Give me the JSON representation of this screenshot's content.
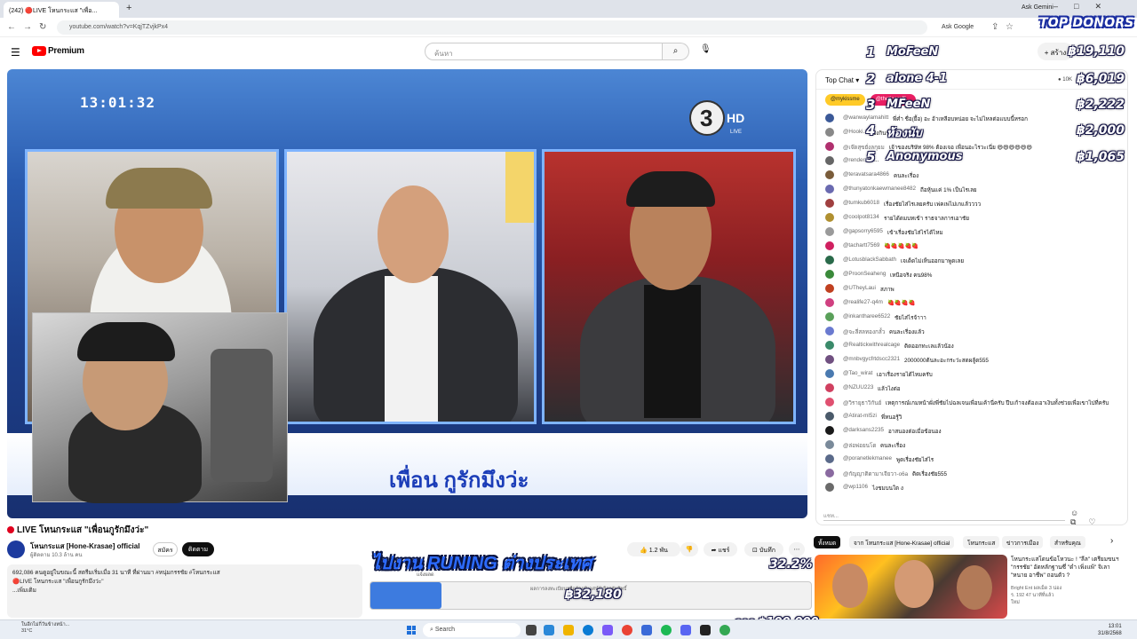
{
  "browser": {
    "tab_title": "(242) 🔴LIVE โหนกระแส \"เพื่อ...",
    "ask_gemini": "Ask Gemini",
    "url": "youtube.com/watch?v=KqjTZvjkPx4",
    "ask_google": "Ask Google"
  },
  "header": {
    "logo_text": "Premium",
    "search_placeholder": "ค้นหา",
    "create_label": "สร้าง"
  },
  "video": {
    "clock": "13:01:32",
    "channel_logo": "3 HD",
    "caption": "เพื่อน กูรักมึงว่ะ"
  },
  "watch": {
    "title": "LIVE โหนกระแส \"เพื่อนกูรักมึงว่ะ\"",
    "channel_name": "โหนกระแส [Hone-Krasae] official",
    "subscribers": "ผู้ติดตาม 10.3 ล้าน คน",
    "join_label": "สมัคร",
    "subscribe_label": "ติดตาม",
    "like_count": "1.2 พัน",
    "share_label": "แชร์",
    "save_label": "บันทึก",
    "description_lines": [
      "692,086 คนดูอยู่ในขณะนี้  สตรีมเริ่มเมื่อ 31 นาที ที่ผ่านมา  #หนุ่มกรรชัย #โหนกระแส",
      "🔴LIVE โหนกระแส \"เพื่อนกูรักมึงว่ะ\"",
      "...เพิ่มเติม"
    ]
  },
  "chat": {
    "mode_label": "Top Chat",
    "viewers": "10K",
    "pinned": [
      "@mykissme",
      "@thetigeroffi..."
    ],
    "messages": [
      {
        "author": "@wanwaylamahitt",
        "text": "พี่ค่ำ ชื่อ(ยื้อ) อะ อ้าเหลือบหน่อย จะไม่ไหลต่อแบบนี้หรอก",
        "color": "#3b5998"
      },
      {
        "author": "@Hooki...",
        "text": "ซิงกินรักใคร่ๆๆๆๆๆๆๆ",
        "color": "#888888"
      },
      {
        "author": "@เจ๊ดสุขยั่งลกุยม",
        "text": "เจ้าของบริษัท 98% ต้องเจอ เพื่อนอะไรวะเนี่ย 😄😄😄😄😄😄",
        "color": "#b0306e"
      },
      {
        "author": "@render...",
        "text": "...",
        "color": "#666666"
      },
      {
        "author": "@teravatsara4866",
        "text": "คนละเรื่อง",
        "color": "#7a5c3a"
      },
      {
        "author": "@thunyatonkaewmanee8482",
        "text": "ถือหุ้นแค่ 1% เป็นไรเลย",
        "color": "#6a6ab0"
      },
      {
        "author": "@tumkub6018",
        "text": "เรื่องชัยไส่ไรเลยครับ เพ่คเพ่ไม่เกแล้วววว",
        "color": "#a04040"
      },
      {
        "author": "@coolpot8134",
        "text": "รายได้ดมบทเข้า ราธจาลการเอาชัย",
        "color": "#b09030"
      },
      {
        "author": "@gapsorry6595",
        "text": "เข้าเรื่องชัยไส่ไรได้ไหม",
        "color": "#9a9a9a"
      },
      {
        "author": "@tachartt7569",
        "text": "🍓🍓🍓🍓🍓",
        "color": "#d02060"
      },
      {
        "author": "@LotusblackSabbath",
        "text": "เจเด็ดไม่เห็นออกมาพูดเลย",
        "color": "#2a6a4a"
      },
      {
        "author": "@ProonSeaheng",
        "text": "เหนือจริง คน98%",
        "color": "#3a8a3a"
      },
      {
        "author": "@UTheyLaui",
        "text": "สภาพ",
        "color": "#c04020"
      },
      {
        "author": "@realife27-q4m",
        "text": "🍓🍓🍓🍓",
        "color": "#d04080"
      },
      {
        "author": "@inkantharee6522",
        "text": "ชัยไส่ไรจ้าาา",
        "color": "#5aa05a"
      },
      {
        "author": "@จะลี่สลทองกลั้ว",
        "text": "คนละเรื่องแล้ว",
        "color": "#6a7ad0"
      },
      {
        "author": "@Realtickwithrealcage",
        "text": "ติดออกทะเลแล้วน้อง",
        "color": "#3a8a6a"
      },
      {
        "author": "@mnbvgycfrtdscc2321",
        "text": "2000000ต้นละอะกระว่ะสดผลู้ด555",
        "color": "#705080"
      },
      {
        "author": "@Tao_wirat",
        "text": "เอาเรื่องรายได้ไหมครับ",
        "color": "#4a7ab0"
      },
      {
        "author": "@NZUU223",
        "text": "แล้วไงต่อ",
        "color": "#d04060"
      },
      {
        "author": "@วิรายุธาวิกันย์",
        "text": "เหตุการณ์เกมหน้าผั่งพี่ชัยไปฉลเจนเพื่อนเค้านี่ครับ ปีบเก้าจงต้องเอาเงินทั้งช่วยเพื่อเขาไปที่ครับ",
        "color": "#e05070"
      },
      {
        "author": "@Atirat-ml5zi",
        "text": "พี่หนอรู้วิ",
        "color": "#4a5a6a"
      },
      {
        "author": "@darksans2235",
        "text": "อาสนองต่อเมื่อข้อนอง",
        "color": "#1a1a1a"
      },
      {
        "author": "@ล่อพ่อยนโด",
        "text": "คนละเรื่อง",
        "color": "#7a8a9a"
      },
      {
        "author": "@poranetlekmanee",
        "text": "พูดเรื่องชัยไส่ไร",
        "color": "#5a6a8a"
      },
      {
        "author": "@กัญญาติดามาเจียวา-o6a",
        "text": "ติดเรื่องชัย555",
        "color": "#8a6aa0"
      },
      {
        "author": "@wp1106",
        "text": "ไงชมบนใต ง",
        "color": "#6a6a6a"
      }
    ],
    "input_placeholder": "แชท..."
  },
  "recommendations": {
    "tabs": [
      "ทั้งหมด",
      "จาก โหนกระแส [Hone-Krasae] official",
      "โหนกระแส",
      "ข่าวการเมือง",
      "สำหรับคุณ"
    ],
    "video_title": "โหนกระแสโดนข้อโหวนะ ! \"ลีล\" เตรียมขนฯ \"กรรชัย\" อัดหลักฐานซึ่ \"ดำ เพิ่งแพ้\" จิเลา \"หนาย อาชีพ\" ถอนตัว ?",
    "video_channel": "Bright Ent ผลเม็ด 3 น่อง",
    "video_stats": "ร. 192  47 นาทีที่แล้ว",
    "video_badge": "ใหม่"
  },
  "donors": {
    "title": "TOP DONORS",
    "list": [
      {
        "rank": "1",
        "name": "MoFeeN",
        "amount": "฿19,110"
      },
      {
        "rank": "2",
        "name": "alone 4-1",
        "amount": "฿6,019"
      },
      {
        "rank": "3",
        "name": "MFeeN",
        "amount": "฿2,222"
      },
      {
        "rank": "4",
        "name": "ห้องนับ",
        "amount": "฿2,000"
      },
      {
        "rank": "5",
        "name": "Anonymous",
        "amount": "฿1,065"
      }
    ]
  },
  "goal": {
    "title": "ไปงาน RUNING ต่างประเทศ",
    "percent_label": "32.2%",
    "progress_fraction": 0.322,
    "amount": "฿32,180",
    "target": "จาก ฿100,000",
    "bar_text": "แจ้งผลด",
    "bar_subtext": "ผลการลงทะเบียนหรือผู้ถูกนิเวศน์ผู้เลือกรับสิทธิ์"
  },
  "taskbar": {
    "weather_line1": "ในอีกไม่กี่วันข้างหน้า...",
    "weather_line2": "31°C",
    "search_label": "Search",
    "time": "13:01",
    "date": "31/8/2568"
  },
  "colors": {
    "yt_red": "#ff0000",
    "donor_outline": "#1b2ea0",
    "goal_blue": "#3d7bdf"
  }
}
